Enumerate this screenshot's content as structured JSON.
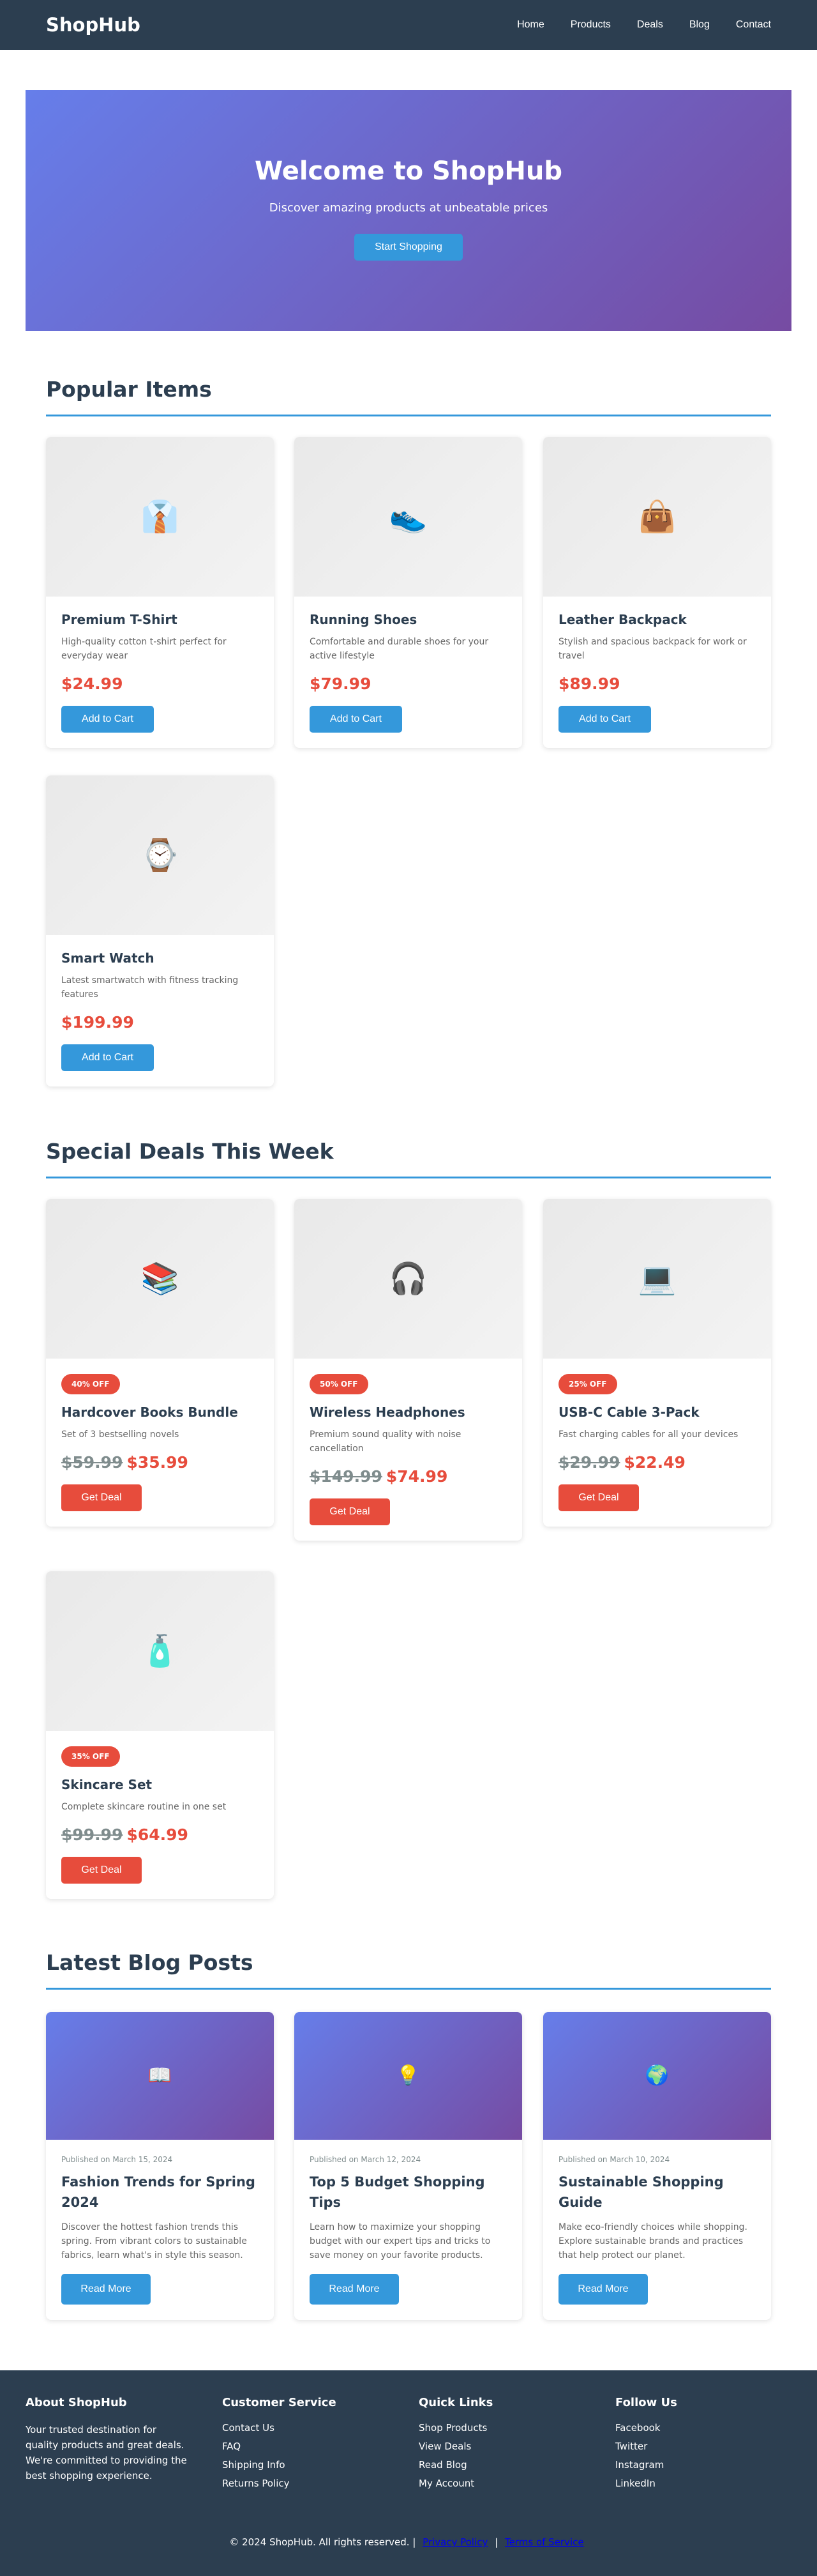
{
  "nav": {
    "logo": "ShopHub",
    "links": [
      "Home",
      "Products",
      "Deals",
      "Blog",
      "Contact"
    ]
  },
  "hero": {
    "title": "Welcome to ShopHub",
    "subtitle": "Discover amazing products at unbeatable prices",
    "button": "Start Shopping"
  },
  "popular": {
    "title": "Popular Items",
    "button_label": "Add to Cart",
    "items": [
      {
        "icon": "shirt-icon",
        "glyph": "👔",
        "name": "Premium T-Shirt",
        "desc": "High-quality cotton t-shirt perfect for everyday wear",
        "price": "$24.99"
      },
      {
        "icon": "shoe-icon",
        "glyph": "👟",
        "name": "Running Shoes",
        "desc": "Comfortable and durable shoes for your active lifestyle",
        "price": "$79.99"
      },
      {
        "icon": "backpack-icon",
        "glyph": "👜",
        "name": "Leather Backpack",
        "desc": "Stylish and spacious backpack for work or travel",
        "price": "$89.99"
      },
      {
        "icon": "watch-icon",
        "glyph": "⌚",
        "name": "Smart Watch",
        "desc": "Latest smartwatch with fitness tracking features",
        "price": "$199.99"
      }
    ]
  },
  "deals": {
    "title": "Special Deals This Week",
    "button_label": "Get Deal",
    "items": [
      {
        "icon": "books-icon",
        "glyph": "📚",
        "badge": "40% OFF",
        "name": "Hardcover Books Bundle",
        "desc": "Set of 3 bestselling novels",
        "old_price": "$59.99",
        "price": "$35.99"
      },
      {
        "icon": "headphones-icon",
        "glyph": "🎧",
        "badge": "50% OFF",
        "name": "Wireless Headphones",
        "desc": "Premium sound quality with noise cancellation",
        "old_price": "$149.99",
        "price": "$74.99"
      },
      {
        "icon": "laptop-icon",
        "glyph": "💻",
        "badge": "25% OFF",
        "name": "USB-C Cable 3-Pack",
        "desc": "Fast charging cables for all your devices",
        "old_price": "$29.99",
        "price": "$22.49"
      },
      {
        "icon": "lotion-icon",
        "glyph": "🧴",
        "badge": "35% OFF",
        "name": "Skincare Set",
        "desc": "Complete skincare routine in one set",
        "old_price": "$99.99",
        "price": "$64.99"
      }
    ]
  },
  "blog": {
    "title": "Latest Blog Posts",
    "button_label": "Read More",
    "posts": [
      {
        "icon": "book-icon",
        "glyph": "📖",
        "date": "Published on March 15, 2024",
        "title": "Fashion Trends for Spring 2024",
        "excerpt": "Discover the hottest fashion trends this spring. From vibrant colors to sustainable fabrics, learn what's in style this season."
      },
      {
        "icon": "lightbulb-icon",
        "glyph": "💡",
        "date": "Published on March 12, 2024",
        "title": "Top 5 Budget Shopping Tips",
        "excerpt": "Learn how to maximize your shopping budget with our expert tips and tricks to save money on your favorite products."
      },
      {
        "icon": "globe-icon",
        "glyph": "🌍",
        "date": "Published on March 10, 2024",
        "title": "Sustainable Shopping Guide",
        "excerpt": "Make eco-friendly choices while shopping. Explore sustainable brands and practices that help protect our planet."
      }
    ]
  },
  "footer": {
    "about_title": "About ShopHub",
    "about_text": "Your trusted destination for quality products and great deals. We're committed to providing the best shopping experience.",
    "service_title": "Customer Service",
    "service_links": [
      "Contact Us",
      "FAQ",
      "Shipping Info",
      "Returns Policy"
    ],
    "quick_title": "Quick Links",
    "quick_links": [
      "Shop Products",
      "View Deals",
      "Read Blog",
      "My Account"
    ],
    "follow_title": "Follow Us",
    "follow_links": [
      "Facebook",
      "Twitter",
      "Instagram",
      "LinkedIn"
    ],
    "copyright": "© 2024 ShopHub. All rights reserved.",
    "separator": "|",
    "privacy": "Privacy Policy",
    "terms": "Terms of Service"
  },
  "colors": {
    "nav_bg": "#2c3e50",
    "accent": "#3498db",
    "price_red": "#e74c3c",
    "hero_gradient_start": "#667eea",
    "hero_gradient_end": "#764ba2"
  }
}
